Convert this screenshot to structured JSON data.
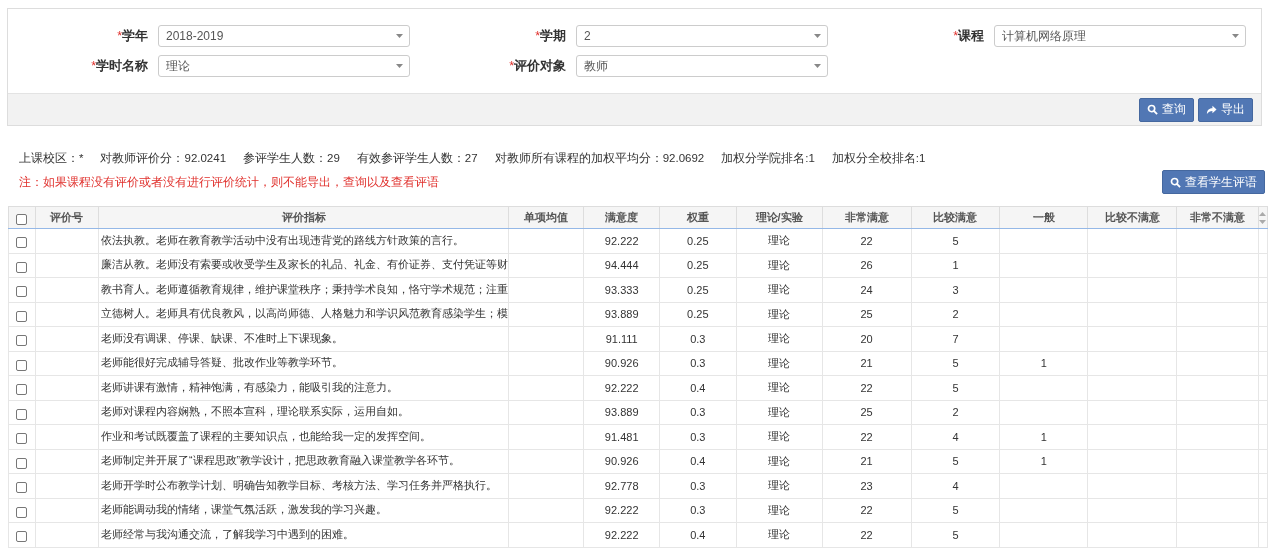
{
  "filters": [
    {
      "required_mark": "*",
      "label": "学年",
      "value": "2018-2019"
    },
    {
      "required_mark": "*",
      "label": "学期",
      "value": "2"
    },
    {
      "required_mark": "*",
      "label": "课程",
      "value": "计算机网络原理"
    },
    {
      "required_mark": "*",
      "label": "学时名称",
      "value": "理论"
    },
    {
      "required_mark": "*",
      "label": "评价对象",
      "value": "教师"
    }
  ],
  "toolbar_buttons": [
    {
      "kind": "search",
      "label": "查询"
    },
    {
      "kind": "export",
      "label": "导出"
    }
  ],
  "stats": [
    "上课校区：*",
    "对教师评价分：92.0241",
    "参评学生人数：29",
    "有效参评学生人数：27",
    "对教师所有课程的加权平均分：92.0692",
    "加权分学院排名:1",
    "加权分全校排名:1"
  ],
  "note": "注：如果课程没有评价或者没有进行评价统计，则不能导出，查询以及查看评语",
  "view_button": {
    "kind": "search",
    "label": "查看学生评语"
  },
  "table": {
    "select_all_checked": false,
    "columns": [
      "评价号",
      "评价指标",
      "单项均值",
      "满意度",
      "权重",
      "理论/实验",
      "非常满意",
      "比较满意",
      "一般",
      "比较不满意",
      "非常不满意"
    ],
    "rows": [
      {
        "checked": false,
        "cells": [
          "",
          "依法执教。老师在教育教学活动中没有出现违背党的路线方针政策的言行。",
          "",
          "92.222",
          "0.25",
          "理论",
          "22",
          "5",
          "",
          "",
          ""
        ]
      },
      {
        "checked": false,
        "cells": [
          "",
          "廉洁从教。老师没有索要或收受学生及家长的礼品、礼金、有价证券、支付凭证等财",
          "",
          "94.444",
          "0.25",
          "理论",
          "26",
          "1",
          "",
          "",
          ""
        ]
      },
      {
        "checked": false,
        "cells": [
          "",
          "教书育人。老师遵循教育规律，维护课堂秩序；秉持学术良知，恪守学术规范；注重",
          "",
          "93.333",
          "0.25",
          "理论",
          "24",
          "3",
          "",
          "",
          ""
        ]
      },
      {
        "checked": false,
        "cells": [
          "",
          "立德树人。老师具有优良教风，以高尚师德、人格魅力和学识风范教育感染学生；模",
          "",
          "93.889",
          "0.25",
          "理论",
          "25",
          "2",
          "",
          "",
          ""
        ]
      },
      {
        "checked": false,
        "cells": [
          "",
          "老师没有调课、停课、缺课、不准时上下课现象。",
          "",
          "91.111",
          "0.3",
          "理论",
          "20",
          "7",
          "",
          "",
          ""
        ]
      },
      {
        "checked": false,
        "cells": [
          "",
          "老师能很好完成辅导答疑、批改作业等教学环节。",
          "",
          "90.926",
          "0.3",
          "理论",
          "21",
          "5",
          "1",
          "",
          ""
        ]
      },
      {
        "checked": false,
        "cells": [
          "",
          "老师讲课有激情，精神饱满，有感染力，能吸引我的注意力。",
          "",
          "92.222",
          "0.4",
          "理论",
          "22",
          "5",
          "",
          "",
          ""
        ]
      },
      {
        "checked": false,
        "cells": [
          "",
          "老师对课程内容娴熟，不照本宣科，理论联系实际，运用自如。",
          "",
          "93.889",
          "0.3",
          "理论",
          "25",
          "2",
          "",
          "",
          ""
        ]
      },
      {
        "checked": false,
        "cells": [
          "",
          "作业和考试既覆盖了课程的主要知识点，也能给我一定的发挥空间。",
          "",
          "91.481",
          "0.3",
          "理论",
          "22",
          "4",
          "1",
          "",
          ""
        ]
      },
      {
        "checked": false,
        "cells": [
          "",
          "老师制定并开展了“课程思政”教学设计，把思政教育融入课堂教学各环节。",
          "",
          "90.926",
          "0.4",
          "理论",
          "21",
          "5",
          "1",
          "",
          ""
        ]
      },
      {
        "checked": false,
        "cells": [
          "",
          "老师开学时公布教学计划、明确告知教学目标、考核方法、学习任务并严格执行。",
          "",
          "92.778",
          "0.3",
          "理论",
          "23",
          "4",
          "",
          "",
          ""
        ]
      },
      {
        "checked": false,
        "cells": [
          "",
          "老师能调动我的情绪，课堂气氛活跃，激发我的学习兴趣。",
          "",
          "92.222",
          "0.3",
          "理论",
          "22",
          "5",
          "",
          "",
          ""
        ]
      },
      {
        "checked": false,
        "cells": [
          "",
          "老师经常与我沟通交流，了解我学习中遇到的困难。",
          "",
          "92.222",
          "0.4",
          "理论",
          "22",
          "5",
          "",
          "",
          ""
        ]
      }
    ]
  }
}
